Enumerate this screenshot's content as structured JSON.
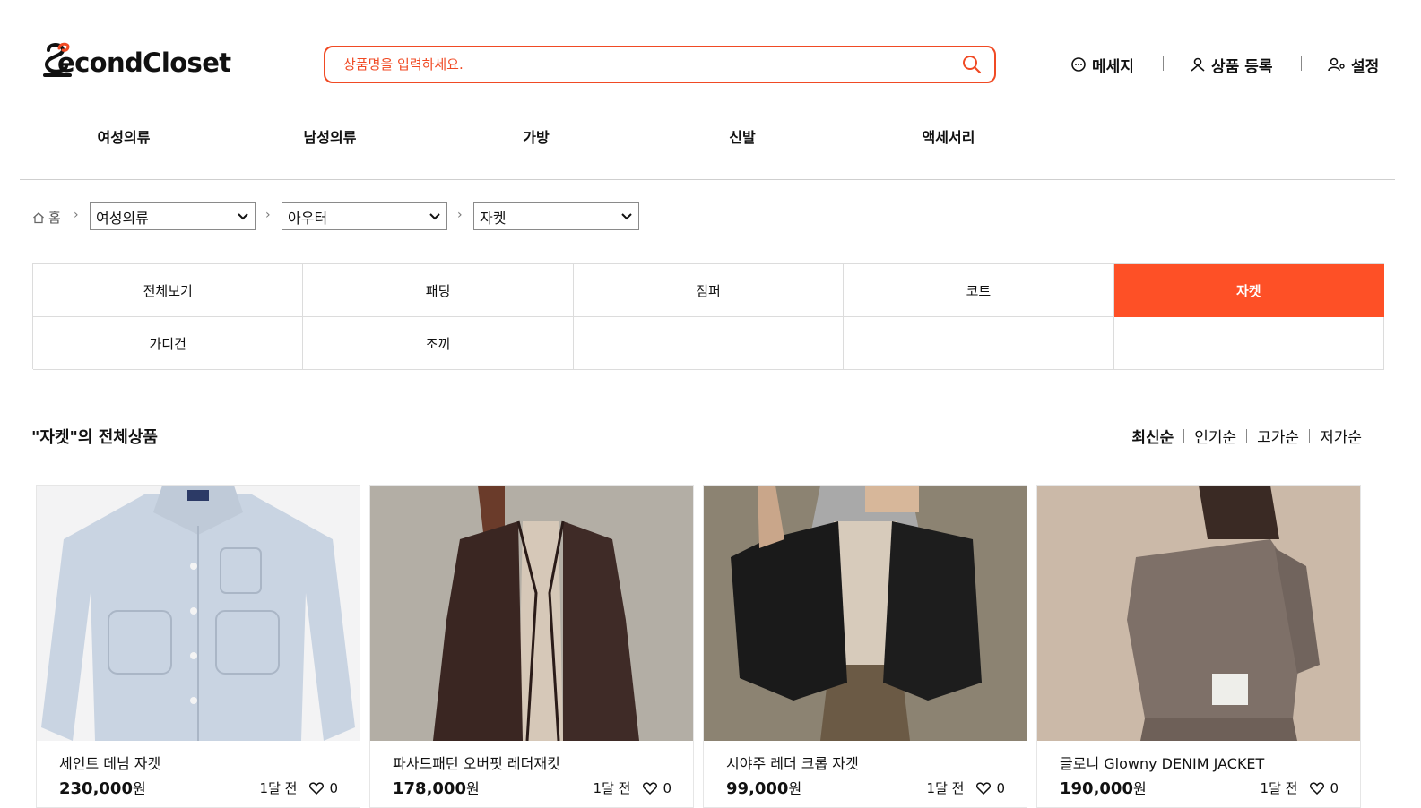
{
  "header": {
    "logo_text": "econdCloset",
    "search_placeholder": "상품명을 입력하세요.",
    "utils": [
      {
        "label": "메세지",
        "icon": "chat-bubble-icon"
      },
      {
        "label": "상품 등록",
        "icon": "user-upload-icon"
      },
      {
        "label": "설정",
        "icon": "user-settings-icon"
      }
    ],
    "accent_color": "#f04a24"
  },
  "categories": [
    "여성의류",
    "남성의류",
    "가방",
    "신발",
    "액세서리"
  ],
  "breadcrumb": {
    "home_label": "홈",
    "selects": [
      "여성의류",
      "아우터",
      "자켓"
    ]
  },
  "subcategories": {
    "items": [
      "전체보기",
      "패딩",
      "점퍼",
      "코트",
      "자켓",
      "가디건",
      "조끼"
    ],
    "active": "자켓",
    "active_color": "#fe5026"
  },
  "listing": {
    "title": "\"자켓\"의 전체상품",
    "sort_options": [
      "최신순",
      "인기순",
      "고가순",
      "저가순"
    ],
    "active_sort": "최신순"
  },
  "products": [
    {
      "name": "세인트 데님 자켓",
      "price": "230,000",
      "currency": "원",
      "time": "1달 전",
      "likes": "0"
    },
    {
      "name": "파사드패턴 오버핏 레더재킷",
      "price": "178,000",
      "currency": "원",
      "time": "1달 전",
      "likes": "0"
    },
    {
      "name": "시야주 레더 크롭 자켓",
      "price": "99,000",
      "currency": "원",
      "time": "1달 전",
      "likes": "0"
    },
    {
      "name": "글로니 Glowny DENIM JACKET",
      "price": "190,000",
      "currency": "원",
      "time": "1달 전",
      "likes": "0"
    }
  ]
}
